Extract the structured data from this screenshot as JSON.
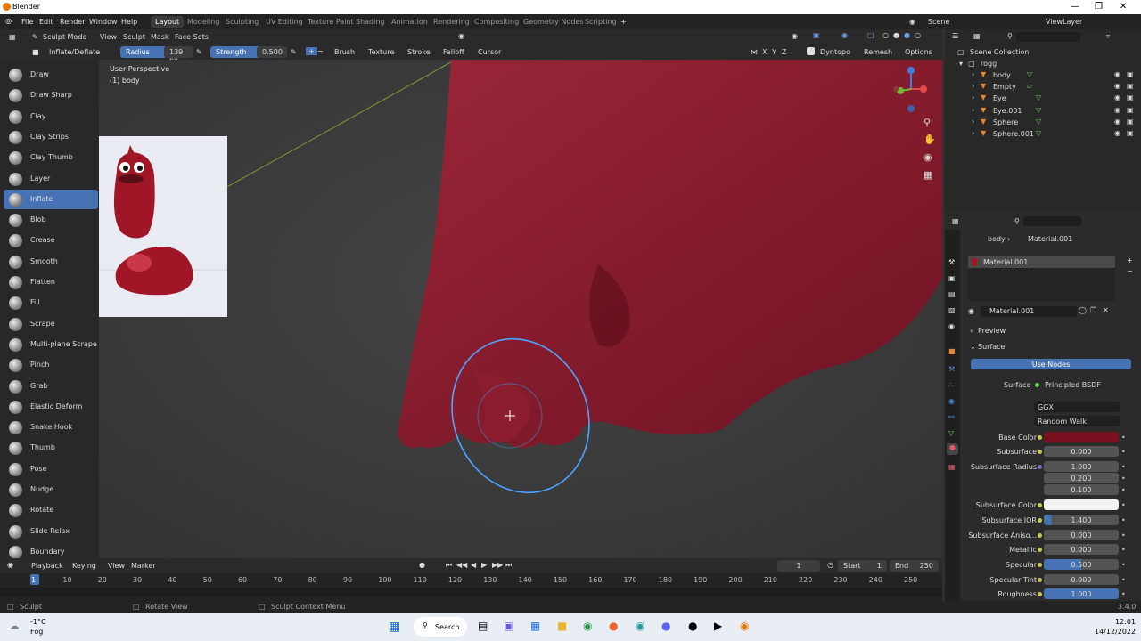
{
  "app": {
    "title": "Blender"
  },
  "menu": [
    "File",
    "Edit",
    "Render",
    "Window",
    "Help"
  ],
  "workspaces": [
    "Layout",
    "Modeling",
    "Sculpting",
    "UV Editing",
    "Texture Paint",
    "Shading",
    "Animation",
    "Rendering",
    "Compositing",
    "Geometry Nodes",
    "Scripting"
  ],
  "scene": {
    "label": "Scene",
    "viewlayer": "ViewLayer"
  },
  "header": {
    "mode": "Sculpt Mode",
    "menus": [
      "View",
      "Sculpt",
      "Mask",
      "Face Sets"
    ]
  },
  "toolsettings": {
    "brush": "Inflate/Deflate",
    "radius_label": "Radius",
    "radius_value": "139 px",
    "strength_label": "Strength",
    "strength_value": "0.500",
    "menus": [
      "Brush",
      "Texture",
      "Stroke",
      "Falloff",
      "Cursor"
    ],
    "axes": [
      "X",
      "Y",
      "Z"
    ],
    "dyntopo": "Dyntopo",
    "remesh": "Remesh",
    "options": "Options"
  },
  "viewport": {
    "perspective": "User Perspective",
    "object": "(1) body",
    "gizmo_colors": {
      "x": "#e44a4a",
      "y": "#79b53a",
      "z": "#3d7fe2"
    }
  },
  "tools": [
    {
      "label": "Draw"
    },
    {
      "label": "Draw Sharp"
    },
    {
      "label": "Clay"
    },
    {
      "label": "Clay Strips"
    },
    {
      "label": "Clay Thumb"
    },
    {
      "label": "Layer"
    },
    {
      "label": "Inflate",
      "active": true
    },
    {
      "label": "Blob"
    },
    {
      "label": "Crease"
    },
    {
      "label": "Smooth"
    },
    {
      "label": "Flatten"
    },
    {
      "label": "Fill"
    },
    {
      "label": "Scrape"
    },
    {
      "label": "Multi-plane Scrape"
    },
    {
      "label": "Pinch"
    },
    {
      "label": "Grab"
    },
    {
      "label": "Elastic Deform"
    },
    {
      "label": "Snake Hook"
    },
    {
      "label": "Thumb"
    },
    {
      "label": "Pose"
    },
    {
      "label": "Nudge"
    },
    {
      "label": "Rotate"
    },
    {
      "label": "Slide Relax"
    },
    {
      "label": "Boundary"
    }
  ],
  "outliner": {
    "root": "Scene Collection",
    "collection": "rogg",
    "items": [
      "body",
      "Empty",
      "Eye",
      "Eye.001",
      "Sphere",
      "Sphere.001"
    ]
  },
  "properties": {
    "breadcrumb": [
      "body",
      "Material.001"
    ],
    "slot": "Material.001",
    "material": "Material.001",
    "preview": "Preview",
    "surface_panel": "Surface",
    "use_nodes": "Use Nodes",
    "surface_label": "Surface",
    "surface_value": "Principled BSDF",
    "distribution": "GGX",
    "subsurface_method": "Random Walk",
    "rows": [
      {
        "label": "Base Color",
        "value": "",
        "color": "#7a1020"
      },
      {
        "label": "Subsurface",
        "value": "0.000"
      },
      {
        "label": "Subsurface Radius",
        "value": "1.000"
      },
      {
        "label": "",
        "value": "0.200"
      },
      {
        "label": "",
        "value": "0.100"
      },
      {
        "label": "Subsurface Color",
        "value": "",
        "color": "#f2f2f2"
      },
      {
        "label": "Subsurface IOR",
        "value": "1.400"
      },
      {
        "label": "Subsurface Aniso...",
        "value": "0.000"
      },
      {
        "label": "Metallic",
        "value": "0.000"
      },
      {
        "label": "Specular",
        "value": "0.500"
      },
      {
        "label": "Specular Tint",
        "value": "0.000"
      },
      {
        "label": "Roughness",
        "value": "1.000"
      }
    ]
  },
  "timeline": {
    "menus": [
      "Playback",
      "Keying",
      "View",
      "Marker"
    ],
    "current_frame": "1",
    "start_label": "Start",
    "start": "1",
    "end_label": "End",
    "end": "250",
    "ticks": [
      "1",
      "10",
      "20",
      "30",
      "40",
      "50",
      "60",
      "70",
      "80",
      "90",
      "100",
      "110",
      "120",
      "130",
      "140",
      "150",
      "160",
      "170",
      "180",
      "190",
      "200",
      "210",
      "220",
      "230",
      "240",
      "250"
    ]
  },
  "status": {
    "left": "Sculpt",
    "middle": "Rotate View",
    "right": "Sculpt Context Menu",
    "version": "3.4.0"
  },
  "taskbar": {
    "weather_temp": "-1°C",
    "weather_desc": "Fog",
    "search": "Search",
    "time": "12:01",
    "date": "14/12/2022"
  }
}
